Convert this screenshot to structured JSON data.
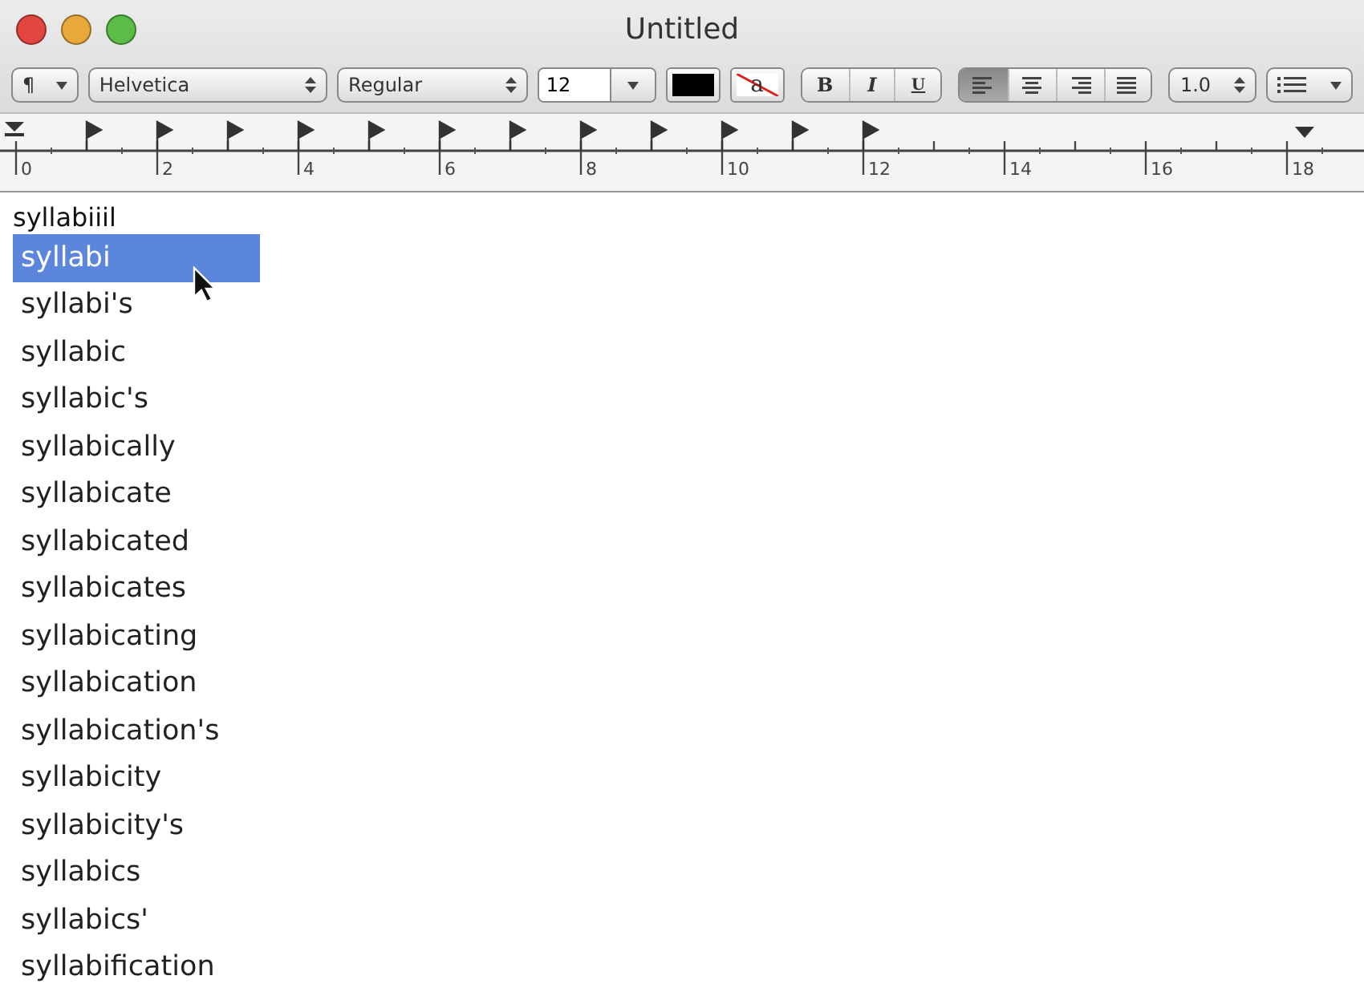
{
  "window": {
    "title": "Untitled"
  },
  "toolbar": {
    "paragraph_menu": "¶",
    "font": "Helvetica",
    "style": "Regular",
    "size": "12",
    "text_styles": [
      {
        "label": "B",
        "selected": false
      },
      {
        "label": "I",
        "selected": false
      },
      {
        "label": "U",
        "selected": false
      }
    ],
    "alignment": [
      {
        "kind": "left",
        "selected": true
      },
      {
        "kind": "center",
        "selected": false
      },
      {
        "kind": "right",
        "selected": false
      },
      {
        "kind": "justify",
        "selected": false
      }
    ],
    "line_spacing": "1.0",
    "highlight_label": "a"
  },
  "ruler": {
    "labels": [
      "0",
      "2",
      "4",
      "6",
      "8",
      "10",
      "12",
      "14",
      "16",
      "18"
    ]
  },
  "document": {
    "typed_text": "syllabiiil",
    "completions": [
      {
        "text": "syllabi",
        "selected": true
      },
      {
        "text": "syllabi's",
        "selected": false
      },
      {
        "text": "syllabic",
        "selected": false
      },
      {
        "text": "syllabic's",
        "selected": false
      },
      {
        "text": "syllabically",
        "selected": false
      },
      {
        "text": "syllabicate",
        "selected": false
      },
      {
        "text": "syllabicated",
        "selected": false
      },
      {
        "text": "syllabicates",
        "selected": false
      },
      {
        "text": "syllabicating",
        "selected": false
      },
      {
        "text": "syllabication",
        "selected": false
      },
      {
        "text": "syllabication's",
        "selected": false
      },
      {
        "text": "syllabicity",
        "selected": false
      },
      {
        "text": "syllabicity's",
        "selected": false
      },
      {
        "text": "syllabics",
        "selected": false
      },
      {
        "text": "syllabics'",
        "selected": false
      },
      {
        "text": "syllabification",
        "selected": false
      }
    ]
  }
}
